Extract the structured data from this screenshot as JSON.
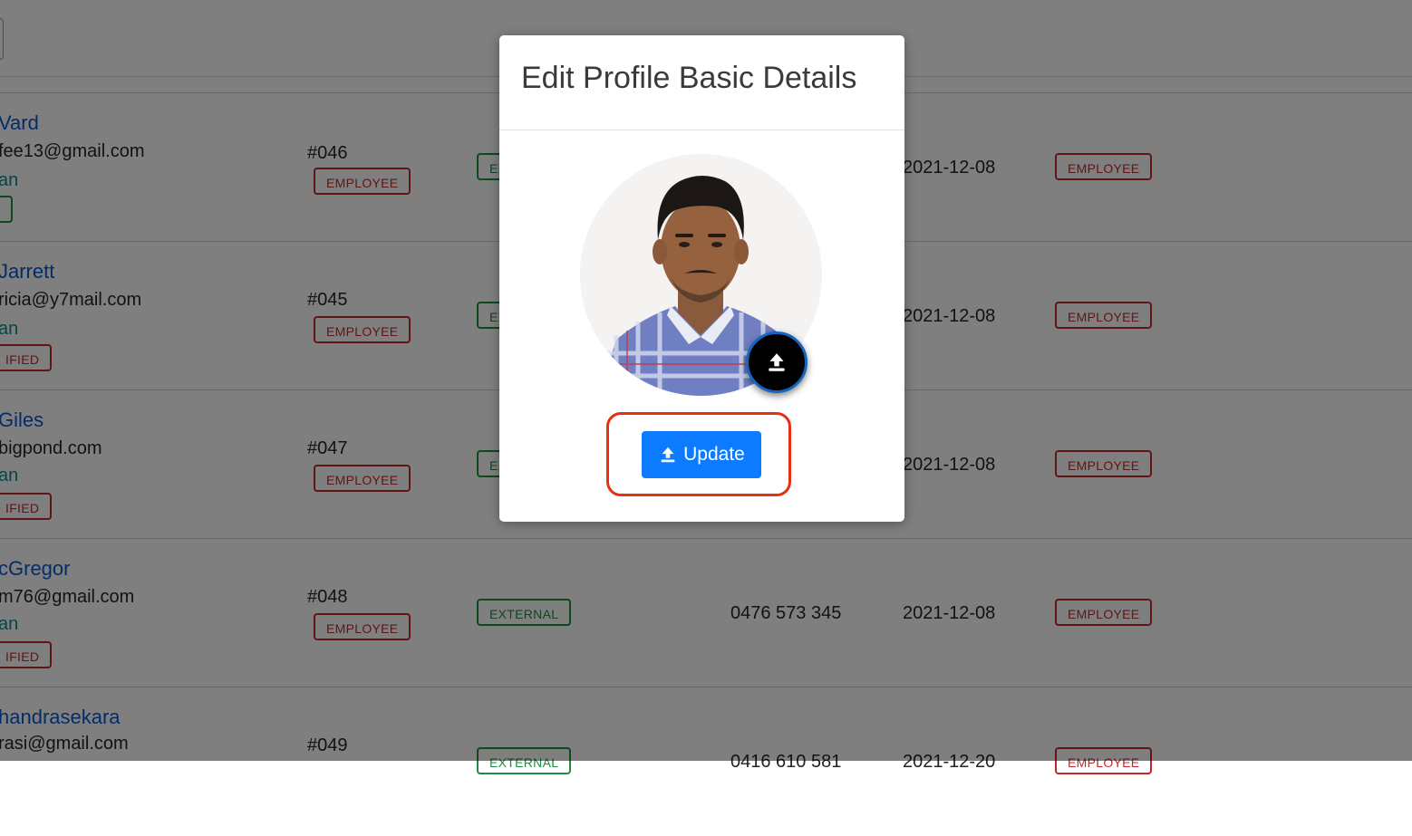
{
  "rows": [
    {
      "name": "Vard",
      "email": "fee13@gmail.com",
      "role": "an",
      "status": "",
      "id": "#046",
      "id_badge": "EMPLOYEE",
      "type_badge": "EX",
      "phone": "",
      "date": "2021-12-08",
      "role_badge": "EMPLOYEE"
    },
    {
      "name": "Jarrett",
      "email": "ricia@y7mail.com",
      "role": "an",
      "status": "IFIED",
      "id": "#045",
      "id_badge": "EMPLOYEE",
      "type_badge": "EX",
      "phone": "",
      "date": "2021-12-08",
      "role_badge": "EMPLOYEE"
    },
    {
      "name": "Giles",
      "email": "bigpond.com",
      "role": "an",
      "status": "IFIED",
      "id": "#047",
      "id_badge": "EMPLOYEE",
      "type_badge": "EX",
      "phone": "",
      "date": "2021-12-08",
      "role_badge": "EMPLOYEE"
    },
    {
      "name": "cGregor",
      "email": "m76@gmail.com",
      "role": "an",
      "status": "IFIED",
      "id": "#048",
      "id_badge": "EMPLOYEE",
      "type_badge": "EXTERNAL",
      "phone": "0476 573 345",
      "date": "2021-12-08",
      "role_badge": "EMPLOYEE"
    },
    {
      "name": "handrasekara",
      "email": "rasi@gmail.com",
      "role": "",
      "status": "",
      "id": "#049",
      "id_badge": "",
      "type_badge": "EXTERNAL",
      "phone": "0416 610 581",
      "date": "2021-12-20",
      "role_badge": "EMPLOYEE"
    }
  ],
  "modal": {
    "title": "Edit Profile Basic Details",
    "update_label": "Update",
    "upload_icon": "upload-icon"
  },
  "colors": {
    "primary": "#0d7bff",
    "highlight": "#e53012",
    "badge_red": "#c62828",
    "badge_green": "#1e8e3e",
    "link": "#0a58ca"
  }
}
